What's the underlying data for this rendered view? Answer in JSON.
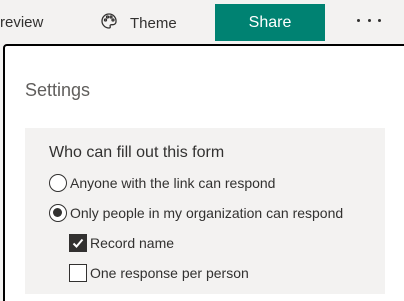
{
  "toolbar": {
    "preview_label": "review",
    "theme_label": "Theme",
    "share_label": "Share",
    "more_icon": "more-dots-icon",
    "theme_icon": "palette-icon",
    "share_color": "#008272"
  },
  "settings": {
    "title": "Settings",
    "section_title": "Who can fill out this form",
    "radio_options": [
      {
        "label": "Anyone with the link can respond",
        "selected": false
      },
      {
        "label": "Only people in my organization can respond",
        "selected": true
      }
    ],
    "checkboxes": [
      {
        "label": "Record name",
        "checked": true
      },
      {
        "label": "One response per person",
        "checked": false
      }
    ]
  }
}
